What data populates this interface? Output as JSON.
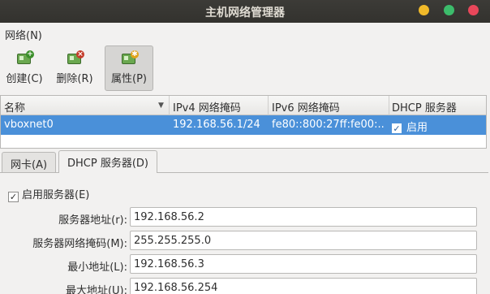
{
  "window": {
    "title": "主机网络管理器"
  },
  "menu": {
    "network": "网络(N)"
  },
  "toolbar": {
    "create": "创建(C)",
    "remove": "删除(R)",
    "properties": "属性(P)"
  },
  "list": {
    "columns": [
      "名称",
      "IPv4 网络掩码",
      "IPv6 网络掩码",
      "DHCP 服务器"
    ],
    "rows": [
      {
        "name": "vboxnet0",
        "ipv4": "192.168.56.1/24",
        "ipv6": "fe80::800:27ff:fe00:...",
        "dhcp_checked": true,
        "dhcp": "启用"
      }
    ]
  },
  "tabs": [
    "网卡(A)",
    "DHCP 服务器(D)"
  ],
  "dhcp": {
    "enable_label": "启用服务器(E)",
    "enabled": true,
    "fields": [
      {
        "label": "服务器地址(r):",
        "value": "192.168.56.2"
      },
      {
        "label": "服务器网络掩码(M):",
        "value": "255.255.255.0"
      },
      {
        "label": "最小地址(L):",
        "value": "192.168.56.3"
      },
      {
        "label": "最大地址(U):",
        "value": "192.168.56.254"
      }
    ]
  }
}
